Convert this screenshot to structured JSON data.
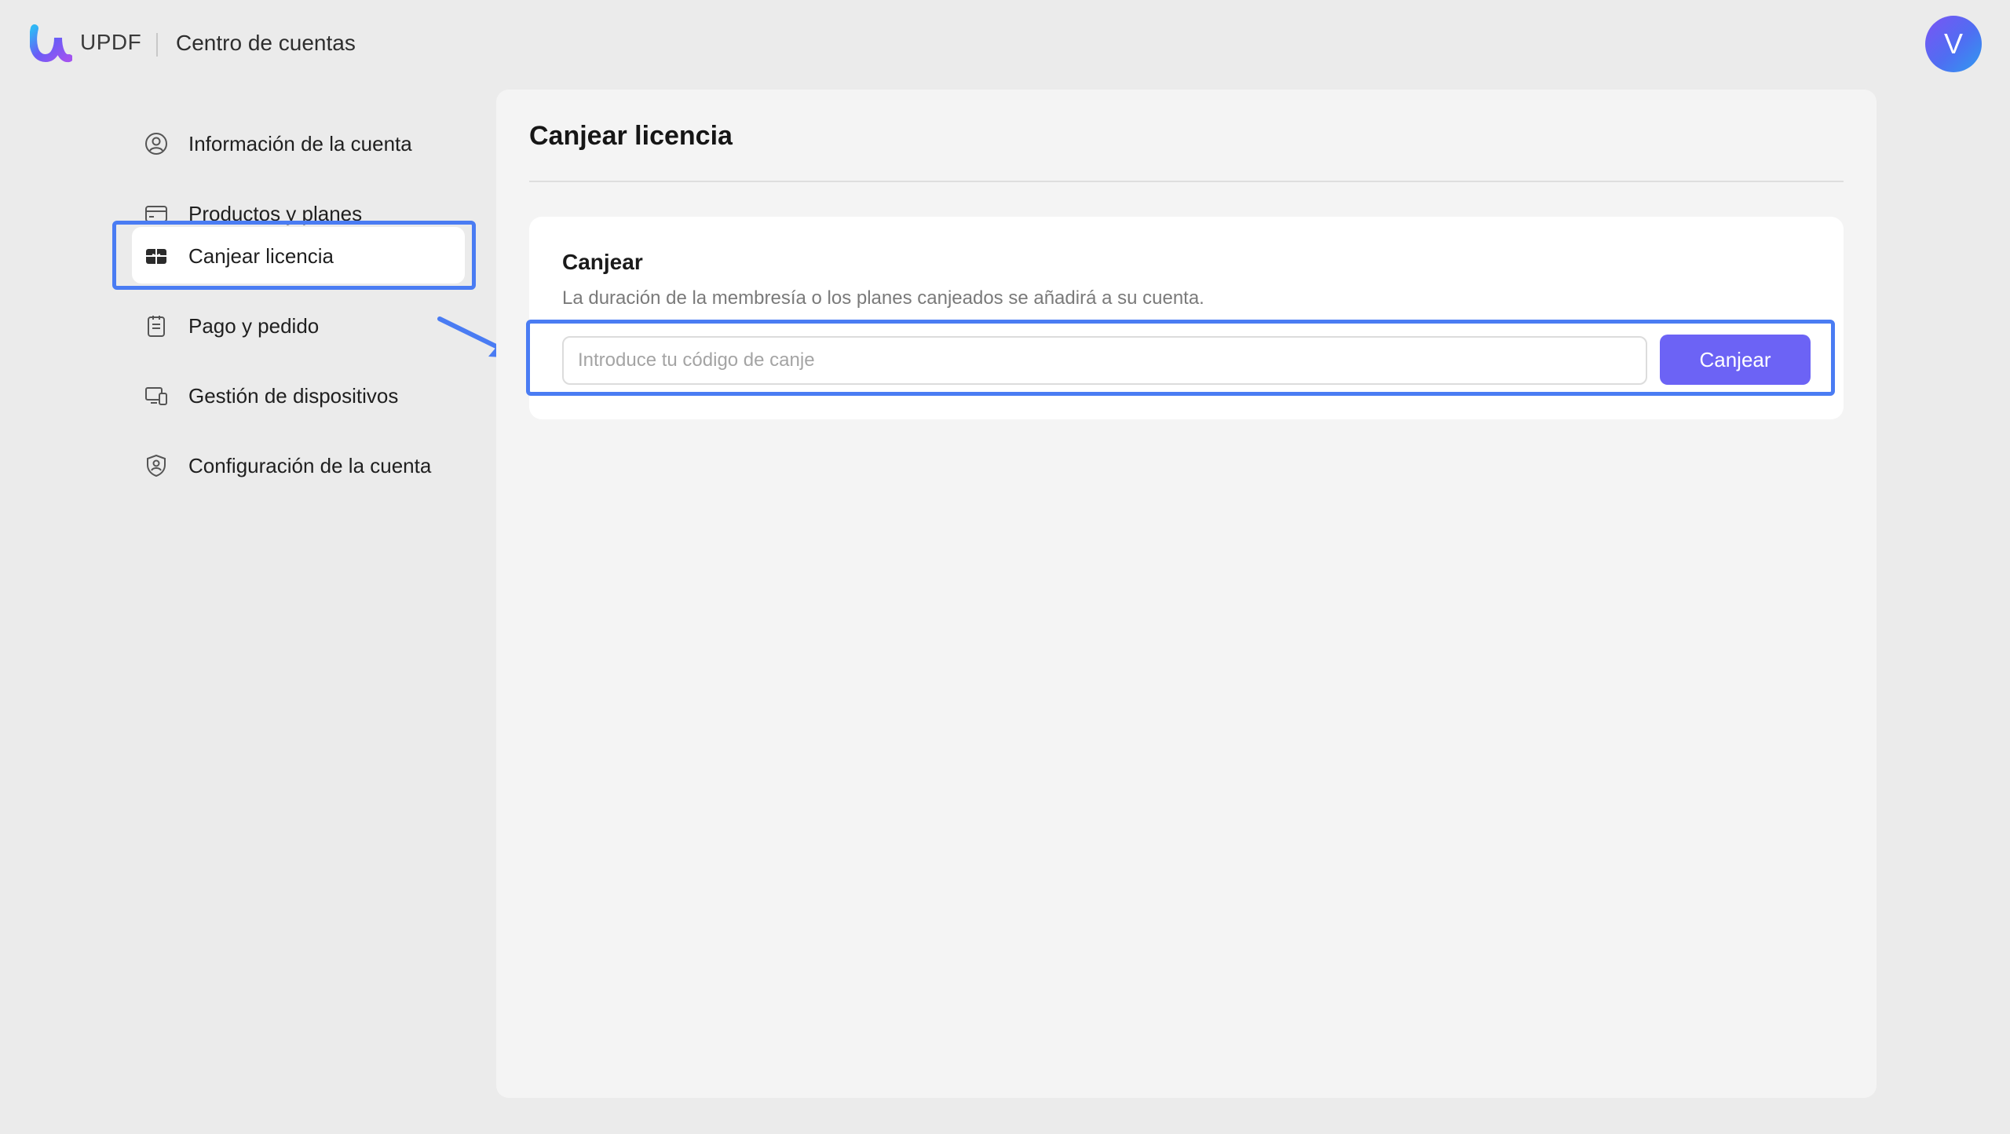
{
  "header": {
    "brand": "UPDF",
    "title": "Centro de cuentas",
    "avatar_initial": "V"
  },
  "sidebar": {
    "items": [
      {
        "label": "Información de la cuenta",
        "icon": "user-circle-icon",
        "active": false
      },
      {
        "label": "Productos y planes",
        "icon": "credit-card-icon",
        "active": false
      },
      {
        "label": "Canjear licencia",
        "icon": "gift-card-icon",
        "active": true
      },
      {
        "label": "Pago y pedido",
        "icon": "receipt-icon",
        "active": false
      },
      {
        "label": "Gestión de dispositivos",
        "icon": "devices-icon",
        "active": false
      },
      {
        "label": "Configuración de la cuenta",
        "icon": "shield-user-icon",
        "active": false
      }
    ]
  },
  "main": {
    "title": "Canjear licencia",
    "card": {
      "title": "Canjear",
      "description": "La duración de la membresía o los planes canjeados se añadirá a su cuenta.",
      "input_placeholder": "Introduce tu código de canje",
      "input_value": "",
      "button_label": "Canjear"
    }
  },
  "colors": {
    "accent": "#6c63f5",
    "highlight": "#4a7cf3",
    "background": "#ebebeb",
    "panel": "#f4f4f4"
  }
}
